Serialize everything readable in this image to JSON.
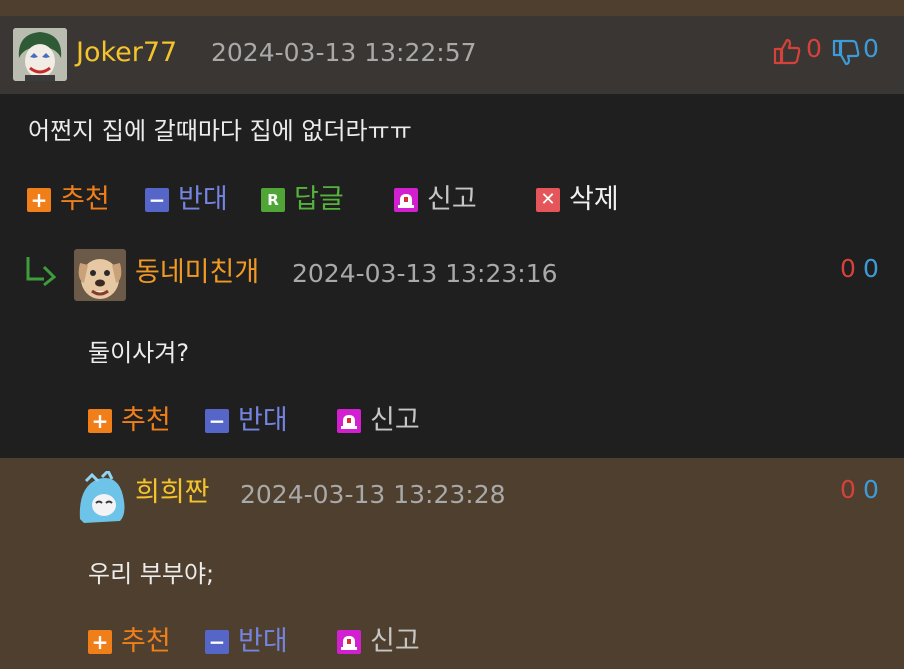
{
  "colors": {
    "username_yellow": "#f5c42c",
    "username_orange": "#f09a25",
    "vote_up_red": "#d6423a",
    "vote_down_blue": "#3d9bd8",
    "action_up": "#f07f1a",
    "action_down": "#5666c8",
    "action_reply": "#4fa637",
    "action_report": "#d21fd0",
    "action_delete": "#e4565a"
  },
  "comments": [
    {
      "author": "Joker77",
      "timestamp": "2024-03-13 13:22:57",
      "text": "어쩐지 집에 갈때마다 집에 없더라ㅠㅠ",
      "upvotes": "0",
      "downvotes": "0",
      "actions": {
        "up": "추천",
        "down": "반대",
        "reply": "답글",
        "report": "신고",
        "delete": "삭제"
      }
    },
    {
      "author": "동네미친개",
      "timestamp": "2024-03-13 13:23:16",
      "text": "둘이사겨?",
      "upvotes": "0",
      "downvotes": "0",
      "actions": {
        "up": "추천",
        "down": "반대",
        "report": "신고"
      }
    },
    {
      "author": "희희짠",
      "timestamp": "2024-03-13 13:23:28",
      "text": "우리 부부야;",
      "upvotes": "0",
      "downvotes": "0",
      "actions": {
        "up": "추천",
        "down": "반대",
        "report": "신고"
      }
    }
  ]
}
